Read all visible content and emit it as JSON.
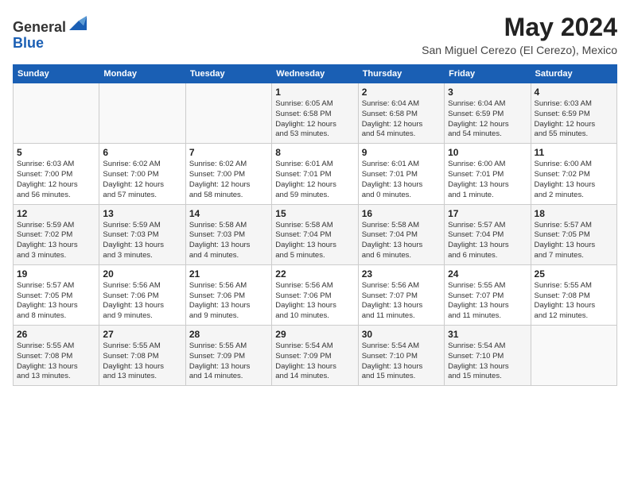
{
  "header": {
    "logo_line1": "General",
    "logo_line2": "Blue",
    "month_title": "May 2024",
    "location": "San Miguel Cerezo (El Cerezo), Mexico"
  },
  "weekdays": [
    "Sunday",
    "Monday",
    "Tuesday",
    "Wednesday",
    "Thursday",
    "Friday",
    "Saturday"
  ],
  "weeks": [
    [
      {
        "day": "",
        "info": ""
      },
      {
        "day": "",
        "info": ""
      },
      {
        "day": "",
        "info": ""
      },
      {
        "day": "1",
        "info": "Sunrise: 6:05 AM\nSunset: 6:58 PM\nDaylight: 12 hours\nand 53 minutes."
      },
      {
        "day": "2",
        "info": "Sunrise: 6:04 AM\nSunset: 6:58 PM\nDaylight: 12 hours\nand 54 minutes."
      },
      {
        "day": "3",
        "info": "Sunrise: 6:04 AM\nSunset: 6:59 PM\nDaylight: 12 hours\nand 54 minutes."
      },
      {
        "day": "4",
        "info": "Sunrise: 6:03 AM\nSunset: 6:59 PM\nDaylight: 12 hours\nand 55 minutes."
      }
    ],
    [
      {
        "day": "5",
        "info": "Sunrise: 6:03 AM\nSunset: 7:00 PM\nDaylight: 12 hours\nand 56 minutes."
      },
      {
        "day": "6",
        "info": "Sunrise: 6:02 AM\nSunset: 7:00 PM\nDaylight: 12 hours\nand 57 minutes."
      },
      {
        "day": "7",
        "info": "Sunrise: 6:02 AM\nSunset: 7:00 PM\nDaylight: 12 hours\nand 58 minutes."
      },
      {
        "day": "8",
        "info": "Sunrise: 6:01 AM\nSunset: 7:01 PM\nDaylight: 12 hours\nand 59 minutes."
      },
      {
        "day": "9",
        "info": "Sunrise: 6:01 AM\nSunset: 7:01 PM\nDaylight: 13 hours\nand 0 minutes."
      },
      {
        "day": "10",
        "info": "Sunrise: 6:00 AM\nSunset: 7:01 PM\nDaylight: 13 hours\nand 1 minute."
      },
      {
        "day": "11",
        "info": "Sunrise: 6:00 AM\nSunset: 7:02 PM\nDaylight: 13 hours\nand 2 minutes."
      }
    ],
    [
      {
        "day": "12",
        "info": "Sunrise: 5:59 AM\nSunset: 7:02 PM\nDaylight: 13 hours\nand 3 minutes."
      },
      {
        "day": "13",
        "info": "Sunrise: 5:59 AM\nSunset: 7:03 PM\nDaylight: 13 hours\nand 3 minutes."
      },
      {
        "day": "14",
        "info": "Sunrise: 5:58 AM\nSunset: 7:03 PM\nDaylight: 13 hours\nand 4 minutes."
      },
      {
        "day": "15",
        "info": "Sunrise: 5:58 AM\nSunset: 7:04 PM\nDaylight: 13 hours\nand 5 minutes."
      },
      {
        "day": "16",
        "info": "Sunrise: 5:58 AM\nSunset: 7:04 PM\nDaylight: 13 hours\nand 6 minutes."
      },
      {
        "day": "17",
        "info": "Sunrise: 5:57 AM\nSunset: 7:04 PM\nDaylight: 13 hours\nand 6 minutes."
      },
      {
        "day": "18",
        "info": "Sunrise: 5:57 AM\nSunset: 7:05 PM\nDaylight: 13 hours\nand 7 minutes."
      }
    ],
    [
      {
        "day": "19",
        "info": "Sunrise: 5:57 AM\nSunset: 7:05 PM\nDaylight: 13 hours\nand 8 minutes."
      },
      {
        "day": "20",
        "info": "Sunrise: 5:56 AM\nSunset: 7:06 PM\nDaylight: 13 hours\nand 9 minutes."
      },
      {
        "day": "21",
        "info": "Sunrise: 5:56 AM\nSunset: 7:06 PM\nDaylight: 13 hours\nand 9 minutes."
      },
      {
        "day": "22",
        "info": "Sunrise: 5:56 AM\nSunset: 7:06 PM\nDaylight: 13 hours\nand 10 minutes."
      },
      {
        "day": "23",
        "info": "Sunrise: 5:56 AM\nSunset: 7:07 PM\nDaylight: 13 hours\nand 11 minutes."
      },
      {
        "day": "24",
        "info": "Sunrise: 5:55 AM\nSunset: 7:07 PM\nDaylight: 13 hours\nand 11 minutes."
      },
      {
        "day": "25",
        "info": "Sunrise: 5:55 AM\nSunset: 7:08 PM\nDaylight: 13 hours\nand 12 minutes."
      }
    ],
    [
      {
        "day": "26",
        "info": "Sunrise: 5:55 AM\nSunset: 7:08 PM\nDaylight: 13 hours\nand 13 minutes."
      },
      {
        "day": "27",
        "info": "Sunrise: 5:55 AM\nSunset: 7:08 PM\nDaylight: 13 hours\nand 13 minutes."
      },
      {
        "day": "28",
        "info": "Sunrise: 5:55 AM\nSunset: 7:09 PM\nDaylight: 13 hours\nand 14 minutes."
      },
      {
        "day": "29",
        "info": "Sunrise: 5:54 AM\nSunset: 7:09 PM\nDaylight: 13 hours\nand 14 minutes."
      },
      {
        "day": "30",
        "info": "Sunrise: 5:54 AM\nSunset: 7:10 PM\nDaylight: 13 hours\nand 15 minutes."
      },
      {
        "day": "31",
        "info": "Sunrise: 5:54 AM\nSunset: 7:10 PM\nDaylight: 13 hours\nand 15 minutes."
      },
      {
        "day": "",
        "info": ""
      }
    ]
  ]
}
